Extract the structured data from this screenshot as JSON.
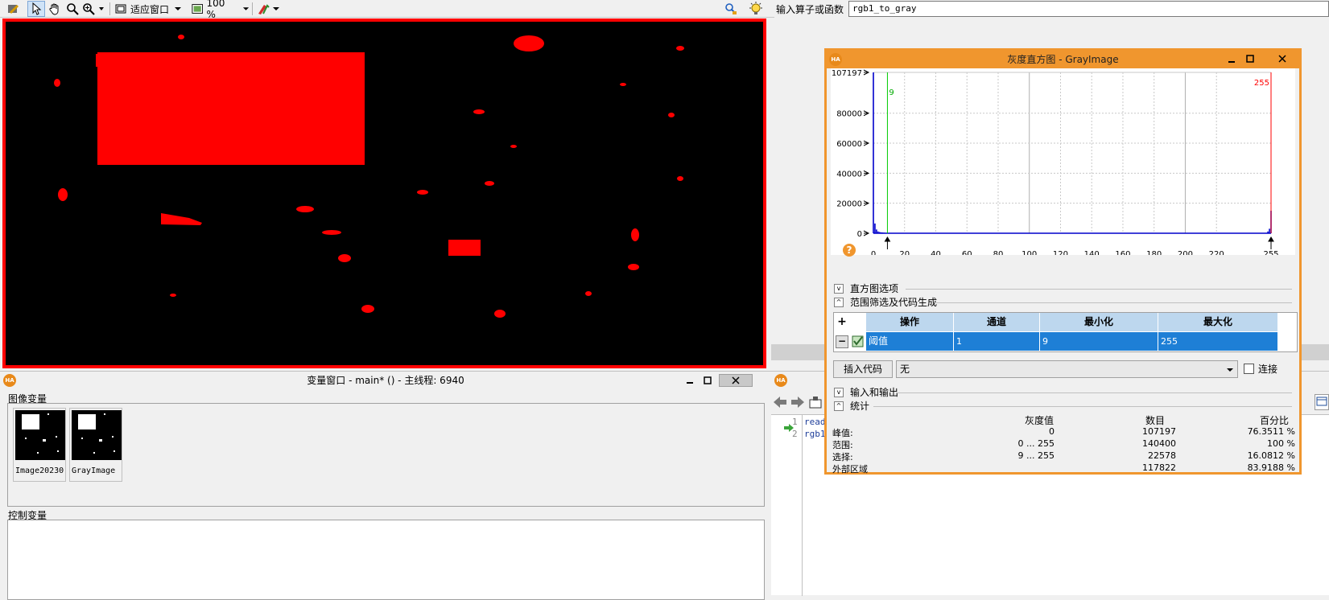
{
  "toolbar": {
    "fit_window_label": "适应窗口",
    "zoom_label": "100 %"
  },
  "operator": {
    "label": "输入算子或函数",
    "value": "rgb1_to_gray"
  },
  "graphics": {
    "background_color": "#000000",
    "region_color": "#ff0000"
  },
  "variable_window": {
    "title": "变量窗口 - main* () - 主线程: 6940",
    "image_vars_title": "图像变量",
    "control_vars_title": "控制变量",
    "images": [
      {
        "name": "Image20230"
      },
      {
        "name": "GrayImage"
      }
    ]
  },
  "program_window": {
    "code_lines": [
      {
        "num": "1",
        "text": "read"
      },
      {
        "num": "2",
        "text": "rgb1"
      }
    ]
  },
  "histogram": {
    "title": "灰度直方图 - GrayImage",
    "min_marker": "9",
    "max_marker": "255",
    "sections": {
      "options": "直方图选项",
      "range": "范围筛选及代码生成",
      "io": "输入和输出",
      "stats": "统计"
    },
    "table": {
      "headers": [
        "操作",
        "通道",
        "最小化",
        "最大化"
      ],
      "row": [
        "阈值",
        "1",
        "9",
        "255"
      ]
    },
    "insert_code_label": "插入代码",
    "insert_select_value": "无",
    "connect_label": "连接",
    "stats": {
      "headers": [
        "灰度值",
        "数目",
        "百分比"
      ],
      "rows": [
        {
          "label": "峰值:",
          "gray": "0",
          "count": "107197",
          "pct": "76.3511 %"
        },
        {
          "label": "范围:",
          "gray": "0 ... 255",
          "count": "140400",
          "pct": "100 %"
        },
        {
          "label": "选择:",
          "gray": "9 ... 255",
          "count": "22578",
          "pct": "16.0812 %"
        },
        {
          "label": "外部区域",
          "gray": "",
          "count": "117822",
          "pct": "83.9188 %"
        }
      ]
    },
    "chart_data": {
      "type": "bar",
      "title": "",
      "xlabel": "",
      "ylabel": "",
      "xlim": [
        0,
        255
      ],
      "ylim": [
        0,
        107197
      ],
      "x_ticks": [
        "0",
        "20",
        "40",
        "60",
        "80",
        "100",
        "120",
        "140",
        "160",
        "180",
        "200",
        "220",
        "255"
      ],
      "y_ticks": [
        "0",
        "20000",
        "40000",
        "60000",
        "80000",
        "107197"
      ],
      "grid": true,
      "min_threshold": 9,
      "max_threshold": 255,
      "bar_color": "#0000cc",
      "x": [
        0,
        1,
        2,
        3,
        4,
        5,
        6,
        7,
        8,
        9,
        10,
        12,
        20,
        40,
        60,
        80,
        100,
        120,
        140,
        160,
        180,
        200,
        220,
        240,
        252,
        253,
        254,
        255
      ],
      "values": [
        107197,
        6500,
        2500,
        1200,
        800,
        600,
        500,
        400,
        300,
        200,
        150,
        100,
        60,
        40,
        40,
        40,
        40,
        40,
        40,
        40,
        40,
        40,
        40,
        60,
        300,
        1200,
        3000,
        15000
      ]
    }
  }
}
